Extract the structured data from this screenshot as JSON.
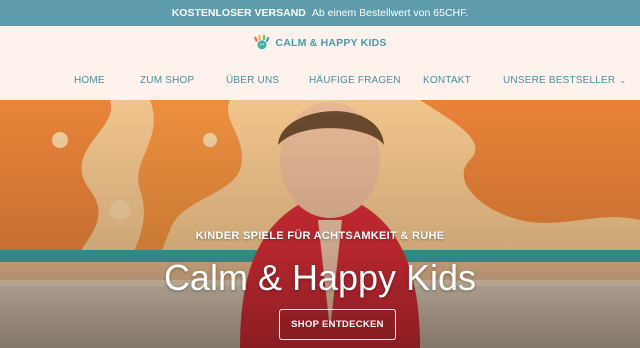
{
  "topbar": {
    "bold": "KOSTENLOSER VERSAND",
    "text": "Ab einem Bestellwert von 65CHF."
  },
  "logo": {
    "name": "CALM & HAPPY KIDS",
    "icon": "colorful-splash-logo-icon"
  },
  "nav": [
    {
      "label": "HOME"
    },
    {
      "label": "ZUM SHOP"
    },
    {
      "label": "ÜBER UNS"
    },
    {
      "label": "HÄUFIGE FRAGEN"
    },
    {
      "label": "KONTAKT"
    },
    {
      "label": "UNSERE BESTSELLER",
      "icon": "chevron-down-icon"
    }
  ],
  "hero": {
    "kicker": "KINDER SPIELE FÜR ACHTSAMKEIT & RUHE",
    "title": "Calm & Happy Kids",
    "cta": "SHOP ENTDECKEN"
  },
  "colors": {
    "topbar": "#5e9cac",
    "header_bg": "#fdf3ec",
    "nav_text": "#4b8e9c",
    "wall_orange": "#e9843a"
  }
}
